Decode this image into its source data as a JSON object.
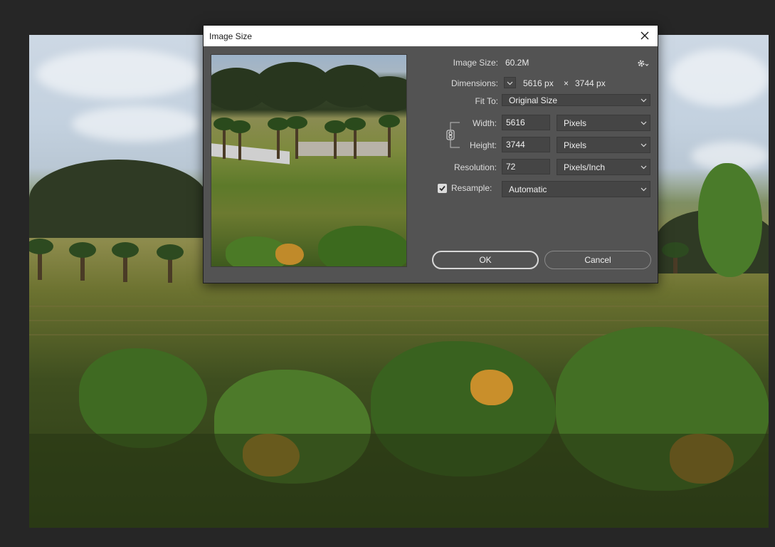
{
  "dialog": {
    "title": "Image Size",
    "image_size_label": "Image Size:",
    "image_size_value": "60.2M",
    "dimensions_label": "Dimensions:",
    "dimensions_width": "5616 px",
    "dimensions_sep": "×",
    "dimensions_height": "3744 px",
    "fit_to_label": "Fit To:",
    "fit_to_value": "Original Size",
    "width_label": "Width:",
    "width_value": "5616",
    "width_unit": "Pixels",
    "height_label": "Height:",
    "height_value": "3744",
    "height_unit": "Pixels",
    "resolution_label": "Resolution:",
    "resolution_value": "72",
    "resolution_unit": "Pixels/Inch",
    "resample_label": "Resample:",
    "resample_checked": true,
    "resample_value": "Automatic",
    "ok_label": "OK",
    "cancel_label": "Cancel"
  },
  "icons": {
    "close": "close-icon",
    "settings": "gear-icon",
    "dimensions_toggle": "chevron-down-icon",
    "constrain": "link-icon",
    "resample_check": "checkmark-icon"
  },
  "colors": {
    "dialog_bg": "#535353",
    "field_bg": "#454545",
    "titlebar_bg": "#ffffff",
    "app_bg": "#262626"
  }
}
